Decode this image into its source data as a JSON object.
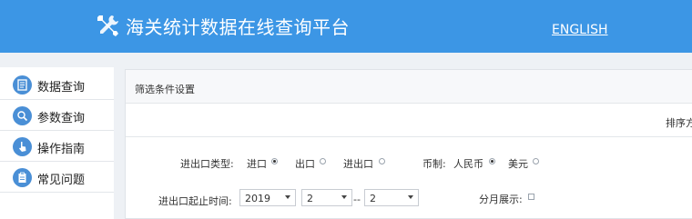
{
  "header": {
    "title": "海关统计数据在线查询平台",
    "lang_link": "ENGLISH",
    "logo_icon": "tools-icon",
    "bg_color": "#3c96e5"
  },
  "sidebar": {
    "items": [
      {
        "label": "数据查询",
        "icon": "document-icon"
      },
      {
        "label": "参数查询",
        "icon": "magnifier-icon"
      },
      {
        "label": "操作指南",
        "icon": "hand-pointer-icon"
      },
      {
        "label": "常见问题",
        "icon": "clipboard-icon"
      }
    ],
    "icon_color": "#4a8fd6"
  },
  "panel": {
    "title": "筛选条件设置",
    "sort_label": "排序方"
  },
  "filters": {
    "trade_type": {
      "label": "进出口类型:",
      "options": [
        {
          "label": "进口",
          "checked": true
        },
        {
          "label": "出口",
          "checked": false
        },
        {
          "label": "进出口",
          "checked": false
        }
      ]
    },
    "currency": {
      "label": "币制:",
      "options": [
        {
          "label": "人民币",
          "checked": true
        },
        {
          "label": "美元",
          "checked": false
        }
      ]
    },
    "time_range": {
      "label": "进出口起止时间:",
      "year": "2019",
      "start_month": "2",
      "separator": "--",
      "end_month": "2"
    },
    "monthly": {
      "label": "分月展示:",
      "checked": false
    }
  }
}
